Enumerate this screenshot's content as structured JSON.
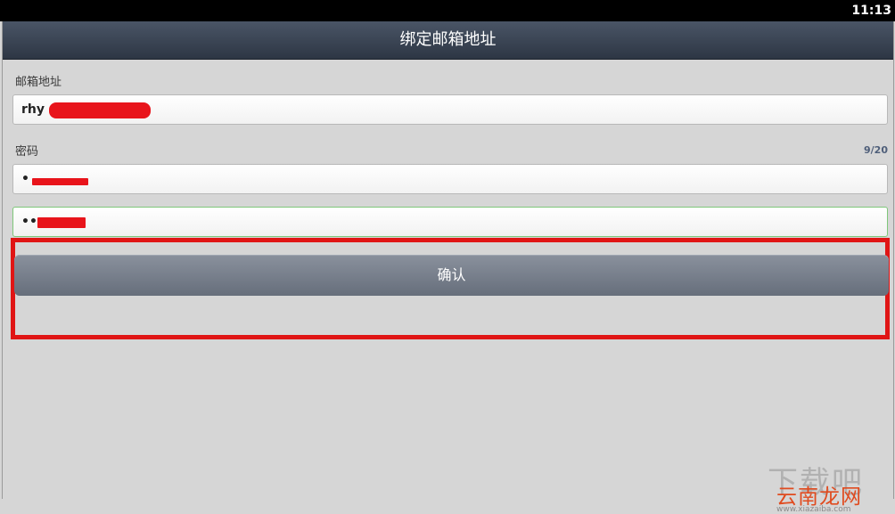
{
  "status_bar": {
    "time": "11:13"
  },
  "header": {
    "title": "绑定邮箱地址"
  },
  "form": {
    "email_label": "邮箱地址",
    "email_value": "rhy",
    "password_label": "密码",
    "password_counter": "9/20",
    "password_value": "•",
    "confirm_password_value": "••",
    "confirm_label": "确认"
  },
  "colors": {
    "title_bar": "#2d3644",
    "button": "#747b87",
    "highlight": "#e01515",
    "focused_border": "#7fc77a"
  }
}
